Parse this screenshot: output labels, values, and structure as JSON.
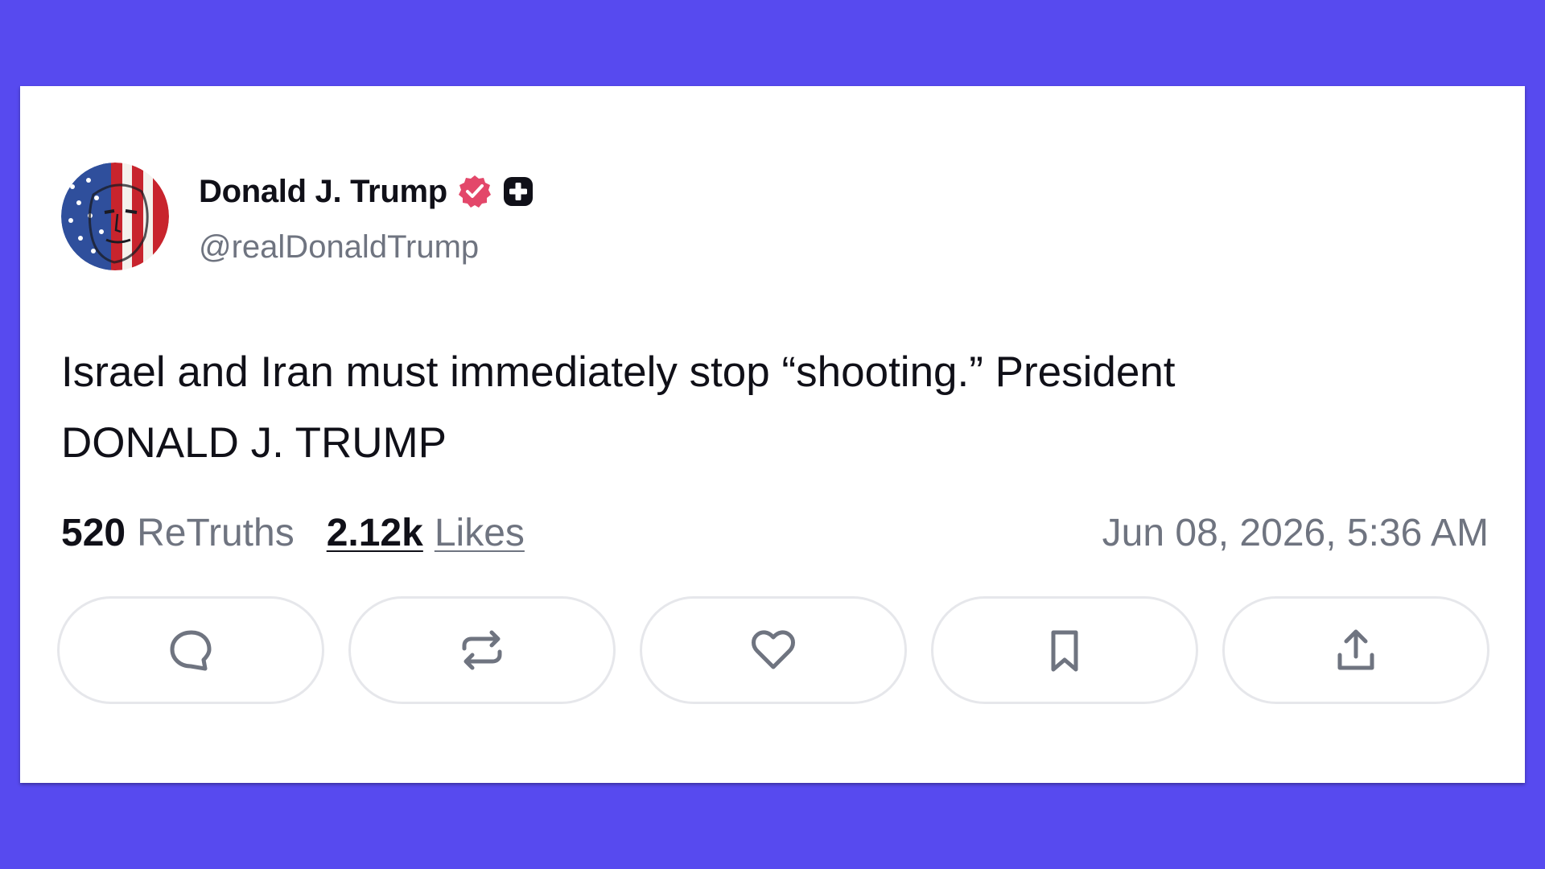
{
  "post": {
    "author": {
      "display_name": "Donald J. Trump",
      "handle": "@realDonaldTrump",
      "verified_icon": "verified-badge-icon",
      "plus_icon": "plus-badge-icon"
    },
    "text_line1": "Israel and Iran must immediately stop “shooting.” President",
    "text_line2": "DONALD J. TRUMP",
    "stats": {
      "retruths_count": "520",
      "retruths_label": "ReTruths",
      "likes_count": "2.12k",
      "likes_label": "Likes"
    },
    "timestamp": "Jun 08, 2026, 5:36 AM",
    "actions": [
      "reply-icon",
      "retruth-icon",
      "like-icon",
      "bookmark-icon",
      "share-icon"
    ]
  },
  "colors": {
    "background": "#574AEF",
    "card": "#FFFFFF",
    "verified": "#E3476A",
    "text_primary": "#101018",
    "text_secondary": "#6F7480"
  }
}
